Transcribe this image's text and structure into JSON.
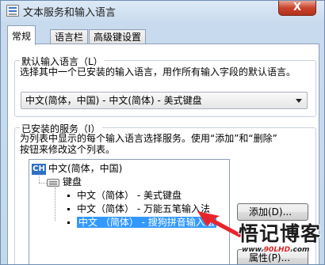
{
  "window": {
    "title": "文本服务和输入语言",
    "close_label": "X"
  },
  "tabs": [
    {
      "label": "常规",
      "active": true
    },
    {
      "label": "语言栏",
      "active": false
    },
    {
      "label": "高级键设置",
      "active": false
    }
  ],
  "default_language": {
    "legend": "默认输入语言（L）",
    "description": "选择其中一个已安装的输入语言，用作所有输入字段的默认语言。",
    "selected": "中文(简体，中国) - 中文(简体) - 美式键盘"
  },
  "installed_services": {
    "legend": "已安装的服务（I）",
    "description_line1": "为列表中显示的每个输入语言选择服务。使用“添加”和“删除”",
    "description_line2": "按钮来修改这个列表。",
    "tree": {
      "language_badge": "CH",
      "language": "中文(简体，中国)",
      "category": "键盘",
      "items": [
        {
          "label": "中文（简体） - 美式键盘",
          "selected": false
        },
        {
          "label": "中文（简体） - 万能五笔输入法",
          "selected": false
        },
        {
          "label": "中文 （简体） - 搜狗拼音输入法",
          "selected": true
        }
      ]
    },
    "add_button": "添加(D)...",
    "properties_button": "属性(P)..."
  },
  "watermark": {
    "brand": "悟记博客",
    "url_prefix": "www.",
    "url_highlight": "90LHD",
    "url_suffix": ".com"
  },
  "colors": {
    "selection": "#3399ff",
    "close_button": "#c8442d",
    "annotation_arrow": "#e8242b"
  }
}
